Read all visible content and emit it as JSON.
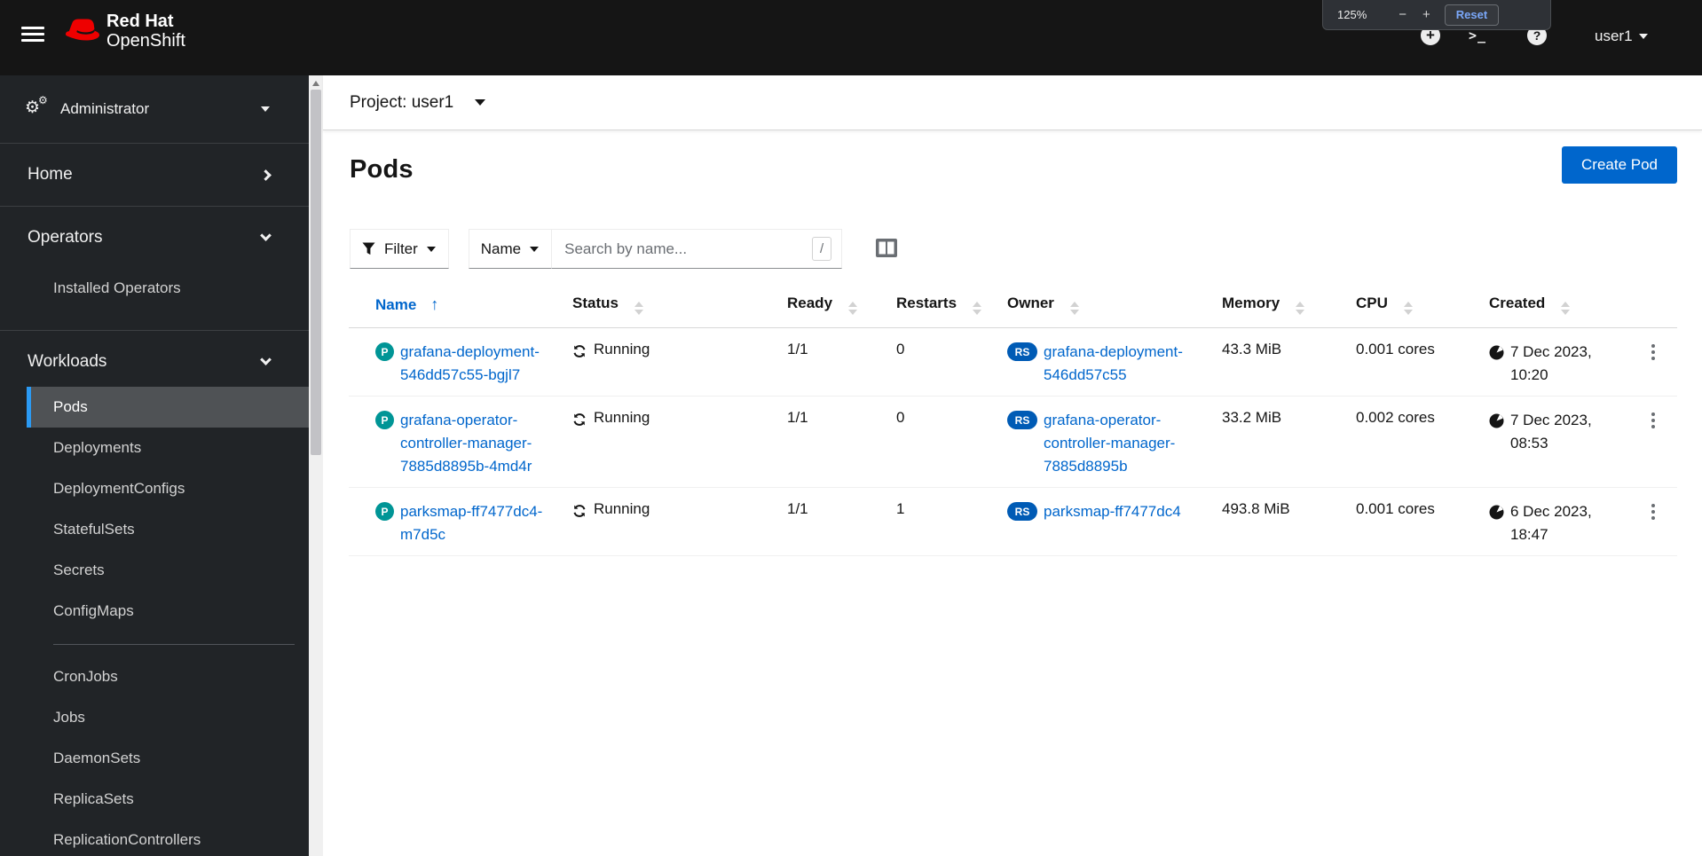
{
  "masthead": {
    "brand_line1": "Red Hat",
    "brand_line2": "OpenShift",
    "username": "user1",
    "icons": [
      "plus-circle-icon",
      "terminal-icon",
      "help-icon"
    ]
  },
  "zoom_overlay": {
    "level": "125%",
    "minus_label": "−",
    "plus_label": "+",
    "reset_label": "Reset"
  },
  "sidebar": {
    "perspective_label": "Administrator",
    "home_label": "Home",
    "operators_label": "Operators",
    "operators_items": [
      "Installed Operators"
    ],
    "workloads_label": "Workloads",
    "workloads_items_a": [
      "Pods",
      "Deployments",
      "DeploymentConfigs",
      "StatefulSets",
      "Secrets",
      "ConfigMaps"
    ],
    "workloads_items_b": [
      "CronJobs",
      "Jobs",
      "DaemonSets",
      "ReplicaSets",
      "ReplicationControllers"
    ],
    "active_item": "Pods"
  },
  "project_bar": {
    "label": "Project: user1"
  },
  "page": {
    "title": "Pods",
    "create_button_label": "Create Pod"
  },
  "toolbar": {
    "filter_label": "Filter",
    "row_filter_label": "Name",
    "search_placeholder": "Search by name...",
    "search_shortcut": "/"
  },
  "table": {
    "columns": [
      "Name",
      "Status",
      "Ready",
      "Restarts",
      "Owner",
      "Memory",
      "CPU",
      "Created"
    ],
    "sorted_by": "Name",
    "sort_direction": "ascending",
    "rows": [
      {
        "badge": "P",
        "name": "grafana-deployment-546dd57c55-bgjl7",
        "name_lines": [
          "grafana-deployment-",
          "546dd57c55-bgjl7"
        ],
        "status": "Running",
        "ready": "1/1",
        "restarts": "0",
        "owner_badge": "RS",
        "owner": "grafana-deployment-546dd57c55",
        "owner_lines": [
          "grafana-deployment-",
          "546dd57c55"
        ],
        "memory": "43.3 MiB",
        "cpu": "0.001 cores",
        "created_date": "7 Dec 2023,",
        "created_time": "10:20"
      },
      {
        "badge": "P",
        "name": "grafana-operator-controller-manager-7885d8895b-4md4r",
        "name_lines": [
          "grafana-operator-",
          "controller-manager-",
          "7885d8895b-4md4r"
        ],
        "status": "Running",
        "ready": "1/1",
        "restarts": "0",
        "owner_badge": "RS",
        "owner": "grafana-operator-controller-manager-7885d8895b",
        "owner_lines": [
          "grafana-operator-",
          "controller-manager-",
          "7885d8895b"
        ],
        "memory": "33.2 MiB",
        "cpu": "0.002 cores",
        "created_date": "7 Dec 2023,",
        "created_time": "08:53"
      },
      {
        "badge": "P",
        "name": "parksmap-ff7477dc4-m7d5c",
        "name_lines": [
          "parksmap-ff7477dc4-",
          "m7d5c"
        ],
        "status": "Running",
        "ready": "1/1",
        "restarts": "1",
        "owner_badge": "RS",
        "owner": "parksmap-ff7477dc4",
        "owner_lines": [
          "parksmap-ff7477dc4"
        ],
        "memory": "493.8 MiB",
        "cpu": "0.001 cores",
        "created_date": "6 Dec 2023,",
        "created_time": "18:47"
      }
    ]
  },
  "colors": {
    "masthead_bg": "#151515",
    "sidebar_bg": "#212427",
    "sidebar_active_bg": "#4f5255",
    "sidebar_active_border": "#2b9af3",
    "link_blue": "#0066cc",
    "primary_button": "#0066cc",
    "pod_badge": "#009596",
    "replicaset_badge": "#005bb5",
    "brand_red": "#ee0000",
    "muted_text": "#6a6e73"
  }
}
